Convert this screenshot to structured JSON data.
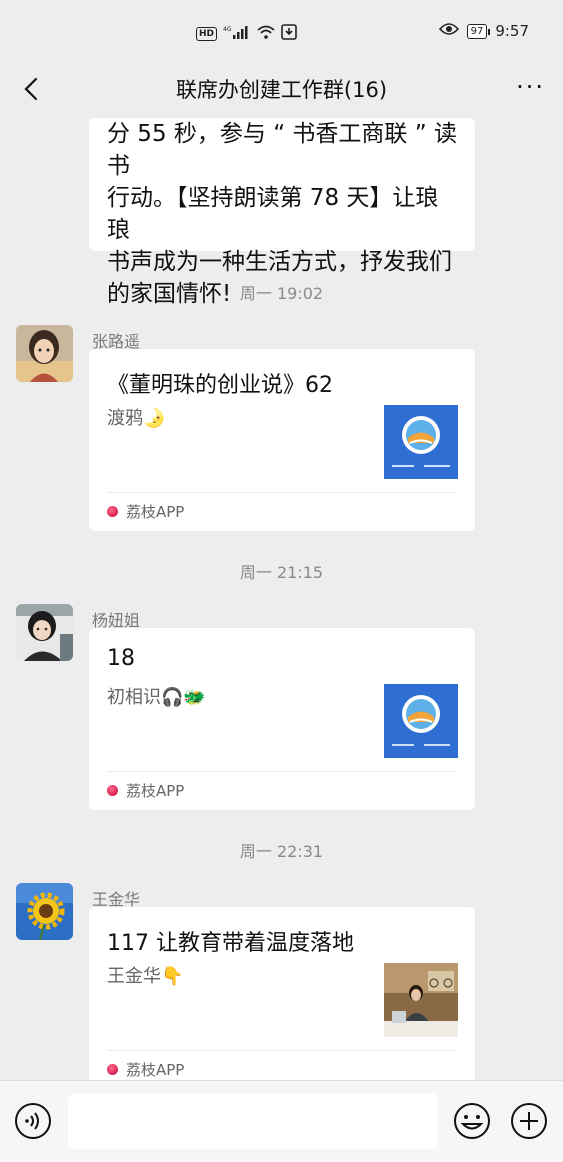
{
  "status_bar": {
    "network": "HD",
    "signal_label": "4G",
    "battery": "97",
    "time": "9:57",
    "icons": [
      "hd-icon",
      "signal-icon",
      "wifi-icon",
      "download-icon",
      "eye-icon",
      "battery-icon"
    ]
  },
  "nav": {
    "title": "联席办创建工作群(16)",
    "back_icon": "chevron-left-icon",
    "more_label": "···"
  },
  "messages": {
    "first_partial": {
      "lines": [
        "分 55 秒，参与 “ 书香工商联 ” 读书",
        "行动。【坚持朗读第 78 天】让琅琅",
        "书声成为一种生活方式，抒发我们",
        "的家国情怀!"
      ]
    },
    "time1": "周一 19:02",
    "msg1": {
      "sender": "张路遥",
      "title": "《董明珠的创业说》62",
      "desc": "渡鸦🌛",
      "source": "荔枝APP"
    },
    "time2": "周一 21:15",
    "msg2": {
      "sender": "杨妞姐",
      "title": "18",
      "desc": "初相识🎧🐲",
      "source": "荔枝APP"
    },
    "time3": "周一 22:31",
    "msg3": {
      "sender": "王金华",
      "title": "117  让教育带着温度落地",
      "desc": "王金华👇",
      "source": "荔枝APP"
    }
  },
  "input_bar": {
    "placeholder": "",
    "icons": [
      "voice-icon",
      "emoji-icon",
      "plus-icon"
    ]
  },
  "colors": {
    "background": "#ededed",
    "bubble": "#ffffff",
    "lizhi": "#d6134d",
    "logo_blue": "#2f6fd3"
  }
}
